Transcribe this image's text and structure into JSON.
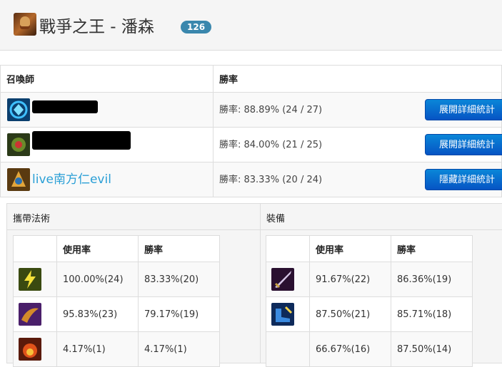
{
  "champion": {
    "title": "戰爭之王 - 潘森",
    "badge": "126",
    "icon": "champion-portrait-icon"
  },
  "stats_table": {
    "headers": [
      "召喚師",
      "勝率"
    ],
    "rows": [
      {
        "name": "",
        "icon": "summoner-avatar-icon",
        "win_rate": "勝率: 88.89% (24 / 27)",
        "button": "展開詳細統計"
      },
      {
        "name": "",
        "icon": "summoner-avatar-icon",
        "win_rate": "勝率: 84.00% (21 / 25)",
        "button": "展開詳細統計"
      },
      {
        "name": "live南方仁evil",
        "icon": "summoner-avatar-icon",
        "win_rate": "勝率: 83.33% (20 / 24)",
        "button": "隱藏詳細統計"
      }
    ]
  },
  "spells": {
    "title": "攜帶法術",
    "headers": [
      "",
      "使用率",
      "勝率"
    ],
    "rows": [
      {
        "icon": "flash-spell-icon",
        "usage": "100.00%(24)",
        "win": "83.33%(20)"
      },
      {
        "icon": "exhaust-spell-icon",
        "usage": "95.83%(23)",
        "win": "79.17%(19)"
      },
      {
        "icon": "ignite-spell-icon",
        "usage": "4.17%(1)",
        "win": "4.17%(1)"
      }
    ]
  },
  "items": {
    "title": "裝備",
    "headers": [
      "",
      "使用率",
      "勝率"
    ],
    "rows": [
      {
        "icon": "sword-item-icon",
        "usage": "91.67%(22)",
        "win": "86.36%(19)"
      },
      {
        "icon": "boots-item-icon",
        "usage": "87.50%(21)",
        "win": "85.71%(18)"
      },
      {
        "icon": "",
        "usage": "66.67%(16)",
        "win": "87.50%(14)"
      }
    ]
  },
  "colors": {
    "badge": "#3a87ad",
    "button": "#0a6fd4",
    "link": "#2a9fd6"
  }
}
